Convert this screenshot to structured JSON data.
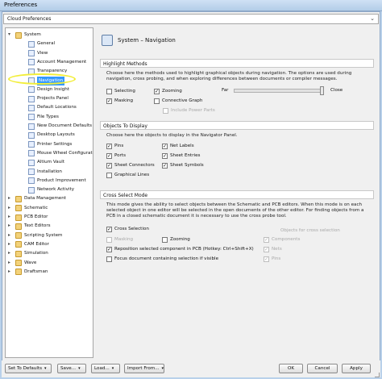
{
  "window": {
    "title": "Preferences"
  },
  "cloud": {
    "label": "Cloud Preferences"
  },
  "tree": [
    {
      "label": "System",
      "level": 0,
      "expand": "−"
    },
    {
      "label": "General",
      "level": 1
    },
    {
      "label": "View",
      "level": 1
    },
    {
      "label": "Account Management",
      "level": 1
    },
    {
      "label": "Transparency",
      "level": 1
    },
    {
      "label": "Navigation",
      "level": 1,
      "selected": true
    },
    {
      "label": "Design Insight",
      "level": 1
    },
    {
      "label": "Projects Panel",
      "level": 1
    },
    {
      "label": "Default Locations",
      "level": 1
    },
    {
      "label": "File Types",
      "level": 1
    },
    {
      "label": "New Document Defaults",
      "level": 1
    },
    {
      "label": "Desktop Layouts",
      "level": 1
    },
    {
      "label": "Printer Settings",
      "level": 1
    },
    {
      "label": "Mouse Wheel Configuration",
      "level": 1
    },
    {
      "label": "Altium Vault",
      "level": 1
    },
    {
      "label": "Installation",
      "level": 1
    },
    {
      "label": "Product Improvement",
      "level": 1
    },
    {
      "label": "Network Activity",
      "level": 1
    },
    {
      "label": "Data Management",
      "level": 0,
      "expand": "+"
    },
    {
      "label": "Schematic",
      "level": 0,
      "expand": "+"
    },
    {
      "label": "PCB Editor",
      "level": 0,
      "expand": "+"
    },
    {
      "label": "Text Editors",
      "level": 0,
      "expand": "+"
    },
    {
      "label": "Scripting System",
      "level": 0,
      "expand": "+"
    },
    {
      "label": "CAM Editor",
      "level": 0,
      "expand": "+"
    },
    {
      "label": "Simulation",
      "level": 0,
      "expand": "+"
    },
    {
      "label": "Wave",
      "level": 0,
      "expand": "+"
    },
    {
      "label": "Draftsman",
      "level": 0,
      "expand": "+"
    }
  ],
  "page": {
    "title": "System – Navigation"
  },
  "highlight": {
    "heading": "Highlight Methods",
    "desc": "Choose here the methods used to highlight graphical objects during navigation. The options are used during navigation, cross probing, and when exploring differences between documents or compiler messages.",
    "selecting": "Selecting",
    "zooming": "Zooming",
    "masking": "Masking",
    "connective": "Connective Graph",
    "include_power": "Include Power Parts",
    "far": "Far",
    "close": "Close",
    "slider_level": 1.0
  },
  "objects": {
    "heading": "Objects To Display",
    "desc": "Choose here the objects to display in the Navigator Panel.",
    "pins": "Pins",
    "net_labels": "Net Labels",
    "ports": "Ports",
    "sheet_entries": "Sheet Entries",
    "sheet_connectors": "Sheet Connectors",
    "sheet_symbols": "Sheet Symbols",
    "graphical_lines": "Graphical Lines"
  },
  "cross": {
    "heading": "Cross Select Mode",
    "desc": "This mode gives the ability to select objects between the Schematic and PCB editors. When this mode is on each selected object in one editor will be selected in the open documents of the other editor. For finding objects from a PCB in a closed schematic document it is necessary to use the cross probe tool.",
    "cross_selection": "Cross Selection",
    "objects_label": "Objects for cross selection",
    "masking": "Masking",
    "zooming": "Zooming",
    "components": "Components",
    "nets": "Nets",
    "reposition": "Reposition selected component in PCB (Hotkey: Ctrl+Shift+X)",
    "focus": "Focus document containing selection if visible",
    "pins": "Pins"
  },
  "buttons": {
    "set_defaults": "Set To Defaults",
    "save": "Save...",
    "load": "Load...",
    "import_from": "Import From...",
    "ok": "OK",
    "cancel": "Cancel",
    "apply": "Apply"
  }
}
